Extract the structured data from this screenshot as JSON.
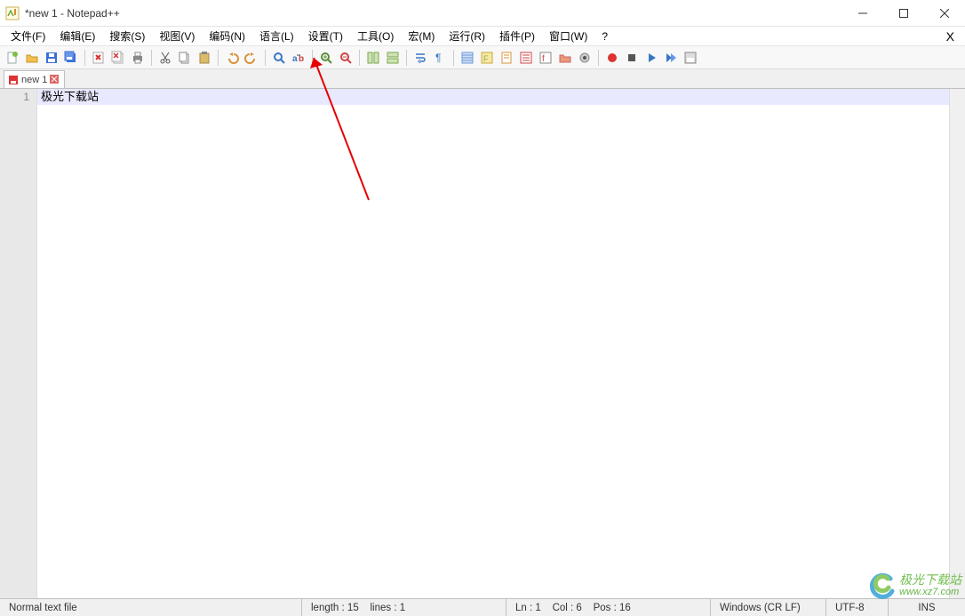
{
  "window": {
    "title": "*new 1 - Notepad++",
    "min_tip": "Minimize",
    "max_tip": "Maximize",
    "close_tip": "Close"
  },
  "menu": {
    "items": [
      "文件(F)",
      "编辑(E)",
      "搜索(S)",
      "视图(V)",
      "编码(N)",
      "语言(L)",
      "设置(T)",
      "工具(O)",
      "宏(M)",
      "运行(R)",
      "插件(P)",
      "窗口(W)",
      "?"
    ],
    "close_x": "X"
  },
  "toolbar": {
    "icons": [
      "new-file-icon",
      "open-folder-icon",
      "save-icon",
      "save-all-icon",
      "sep",
      "print-icon",
      "close-file-icon",
      "close-all-icon",
      "sep",
      "cut-icon",
      "copy-icon",
      "paste-icon",
      "sep",
      "undo-icon",
      "redo-icon",
      "sep",
      "find-icon",
      "replace-icon",
      "sep",
      "zoom-in-icon",
      "zoom-out-icon",
      "sep",
      "sync-v-icon",
      "sync-h-icon",
      "sep",
      "wordwrap-icon",
      "all-chars-icon",
      "sep",
      "indent-guide-icon",
      "lang-icon",
      "doc-map-icon",
      "doc-list-icon",
      "func-list-icon",
      "folder-panel-icon",
      "monitor-icon",
      "sep",
      "record-macro-icon",
      "stop-macro-icon",
      "play-macro-icon",
      "play-multi-icon",
      "save-macro-icon"
    ]
  },
  "tabs": {
    "items": [
      {
        "label": "new 1",
        "dirty": true
      }
    ]
  },
  "editor": {
    "lines": [
      {
        "n": "1",
        "text": "极光下载站"
      }
    ]
  },
  "status": {
    "type": "Normal text file",
    "length_label": "length : 15",
    "lines_label": "lines : 1",
    "ln_label": "Ln : 1",
    "col_label": "Col : 6",
    "pos_label": "Pos : 16",
    "eol": "Windows (CR LF)",
    "encoding": "UTF-8",
    "ins": "INS"
  },
  "watermark": {
    "name": "极光下载站",
    "url": "www.xz7.com"
  }
}
